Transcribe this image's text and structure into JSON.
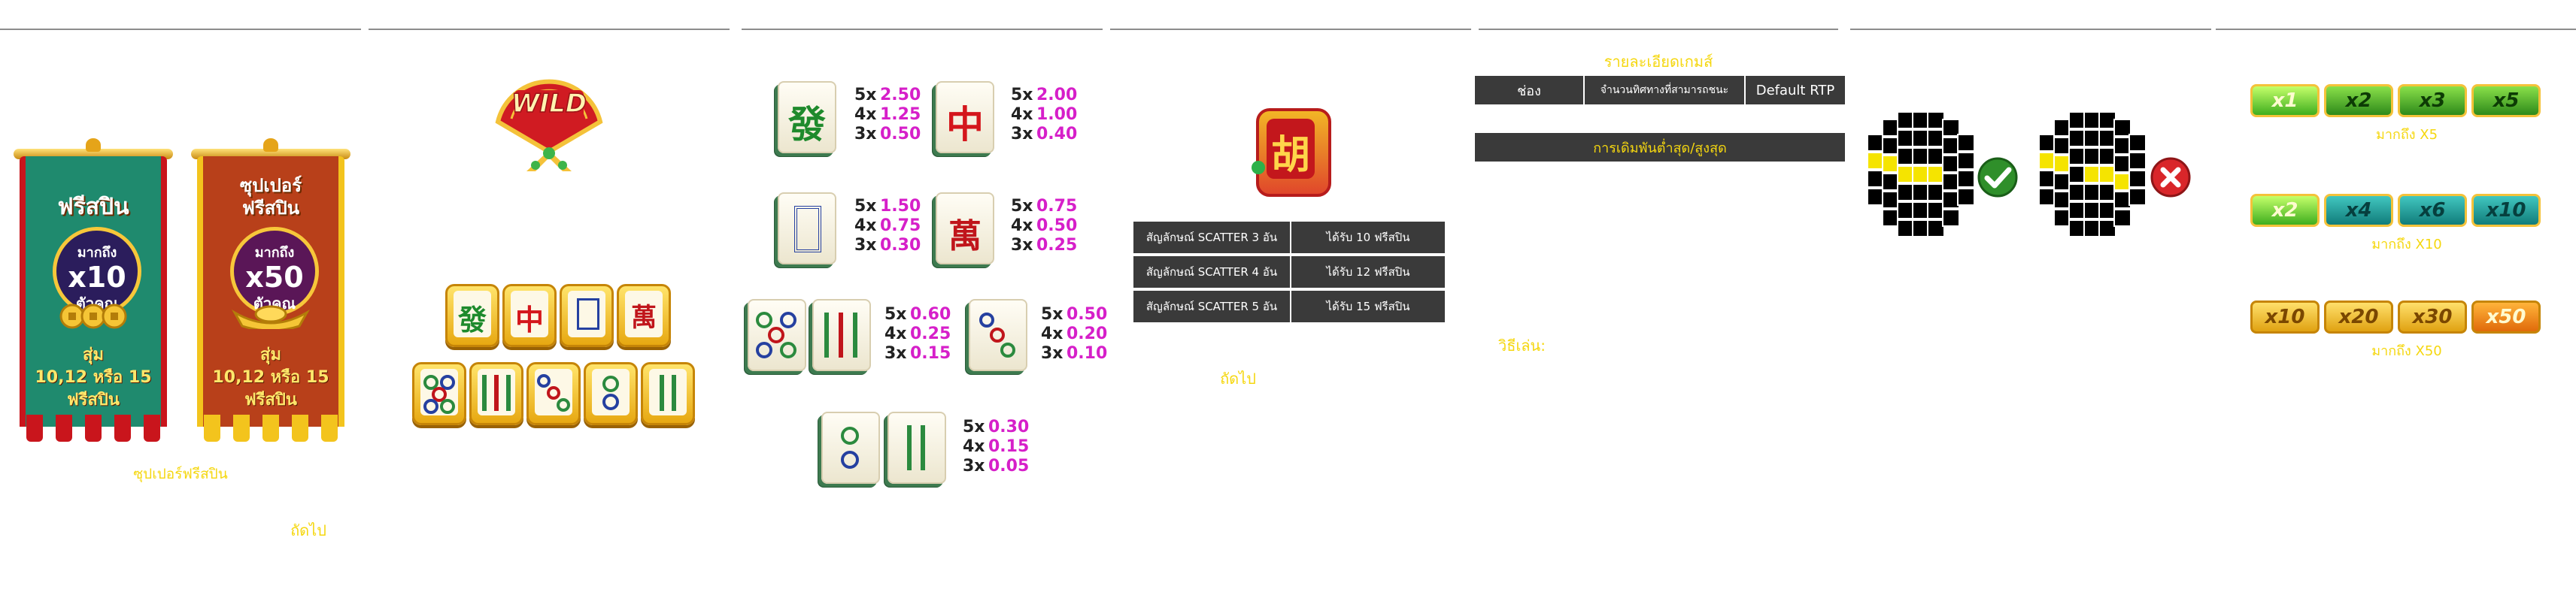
{
  "banners": {
    "left": {
      "title": "ฟรีสปิน",
      "circle_l1": "มากถึง",
      "circle_l2": "x10",
      "circle_l3": "ตัวคูณ",
      "bottom_l1": "สุ่ม",
      "bottom_l2": "10,12 หรือ 15",
      "bottom_l3": "ฟรีสปิน"
    },
    "right": {
      "title_l1": "ซุปเปอร์",
      "title_l2": "ฟรีสปิน",
      "circle_l1": "มากถึง",
      "circle_l2": "x50",
      "circle_l3": "ตัวคูณ",
      "bottom_l1": "สุ่ม",
      "bottom_l2": "10,12 หรือ 15",
      "bottom_l3": "ฟรีสปิน"
    }
  },
  "captions": {
    "super_free_spin": "ซุปเปอร์ฟรีสปิน",
    "next_1": "ถัดไป",
    "next_2": "ถัดไป",
    "game_details": "รายละเอียดเกมส์",
    "how_to_play": "วิธีเล่น:"
  },
  "wild": {
    "label": "WILD"
  },
  "paytable": [
    {
      "symbol": "green-fa",
      "glyph": "發",
      "rows": [
        {
          "k": "5x",
          "v": "2.50"
        },
        {
          "k": "4x",
          "v": "1.25"
        },
        {
          "k": "3x",
          "v": "0.50"
        }
      ]
    },
    {
      "symbol": "red-zhong",
      "glyph": "中",
      "rows": [
        {
          "k": "5x",
          "v": "2.00"
        },
        {
          "k": "4x",
          "v": "1.00"
        },
        {
          "k": "3x",
          "v": "0.40"
        }
      ]
    },
    {
      "symbol": "white-frame",
      "glyph": "",
      "rows": [
        {
          "k": "5x",
          "v": "1.50"
        },
        {
          "k": "4x",
          "v": "0.75"
        },
        {
          "k": "3x",
          "v": "0.30"
        }
      ]
    },
    {
      "symbol": "wan",
      "glyph": "萬",
      "rows": [
        {
          "k": "5x",
          "v": "0.75"
        },
        {
          "k": "4x",
          "v": "0.50"
        },
        {
          "k": "3x",
          "v": "0.25"
        }
      ]
    },
    {
      "symbol": "five-dots-eight-bamboo",
      "glyph": "",
      "rows": [
        {
          "k": "5x",
          "v": "0.60"
        },
        {
          "k": "4x",
          "v": "0.25"
        },
        {
          "k": "3x",
          "v": "0.15"
        }
      ]
    },
    {
      "symbol": "three-dots",
      "glyph": "",
      "rows": [
        {
          "k": "5x",
          "v": "0.50"
        },
        {
          "k": "4x",
          "v": "0.20"
        },
        {
          "k": "3x",
          "v": "0.10"
        }
      ]
    },
    {
      "symbol": "two-dots-two-bamboo",
      "glyph": "",
      "rows": [
        {
          "k": "5x",
          "v": "0.30"
        },
        {
          "k": "4x",
          "v": "0.15"
        },
        {
          "k": "3x",
          "v": "0.05"
        }
      ]
    }
  ],
  "wild_tiles_top": [
    "發",
    "中",
    "",
    "萬"
  ],
  "scatter": {
    "glyph": "胡",
    "rows": [
      {
        "symbol": "สัญลักษณ์ SCATTER 3 อัน",
        "reward": "ได้รับ 10 ฟรีสปิน"
      },
      {
        "symbol": "สัญลักษณ์ SCATTER 4 อัน",
        "reward": "ได้รับ 12 ฟรีสปิน"
      },
      {
        "symbol": "สัญลักษณ์ SCATTER 5 อัน",
        "reward": "ได้รับ 15 ฟรีสปิน"
      }
    ]
  },
  "details_table": {
    "col1": "ช่อง",
    "col2": "จำนวนทิศทางที่สามารถชนะ",
    "col3": "Default RTP",
    "bet_row": "การเดิมพันต่ำสุด/สูงสุด"
  },
  "multipliers": {
    "groups": [
      {
        "labels": [
          "x1",
          "x2",
          "x3",
          "x5"
        ],
        "caption": "มากถึง X5"
      },
      {
        "labels": [
          "x2",
          "x4",
          "x6",
          "x10"
        ],
        "caption": "มากถึง X10"
      },
      {
        "labels": [
          "x10",
          "x20",
          "x30",
          "x50"
        ],
        "caption": "มากถึง X50"
      }
    ]
  },
  "colors": {
    "caption_yellow": "#f5d70f",
    "table_dark": "#3a3a3a",
    "pay_magenta": "#d61fc9",
    "check_green": "#2f8f2a",
    "cross_red": "#d9262a"
  }
}
